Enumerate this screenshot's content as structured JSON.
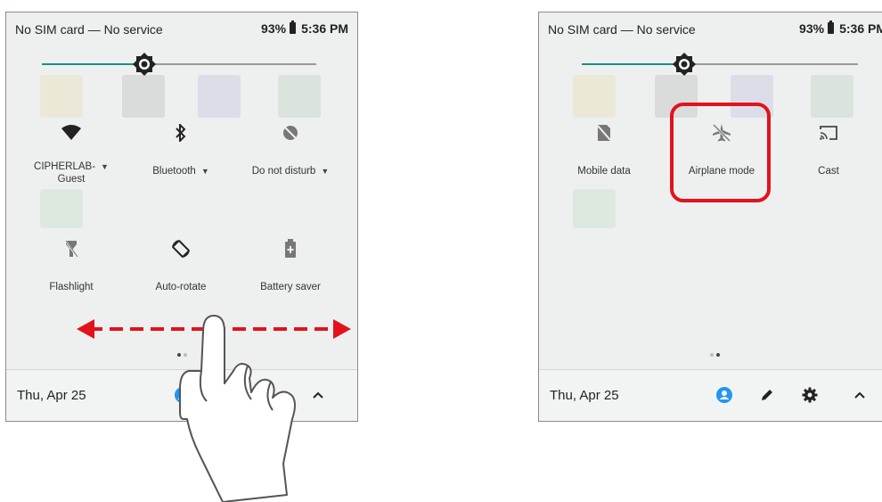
{
  "left_panel": {
    "status": {
      "carrier": "No SIM card — No service",
      "battery": "93%",
      "time": "5:36 PM"
    },
    "tiles": [
      {
        "label": "CIPHERLAB-\nGuest",
        "icon": "wifi-icon",
        "dropdown": true
      },
      {
        "label": "Bluetooth",
        "icon": "bluetooth-icon",
        "dropdown": true
      },
      {
        "label": "Do not disturb",
        "icon": "do-not-disturb-icon",
        "dropdown": true
      },
      {
        "label": "Flashlight",
        "icon": "flashlight-off-icon",
        "dropdown": false
      },
      {
        "label": "Auto-rotate",
        "icon": "auto-rotate-icon",
        "dropdown": false
      },
      {
        "label": "Battery saver",
        "icon": "battery-saver-icon",
        "dropdown": false
      }
    ],
    "page_indicator": {
      "pages": 2,
      "active": 0
    },
    "footer": {
      "date": "Thu, Apr 25"
    }
  },
  "right_panel": {
    "status": {
      "carrier": "No SIM card — No service",
      "battery": "93%",
      "time": "5:36 PM"
    },
    "tiles": [
      {
        "label": "Mobile data",
        "icon": "mobile-data-off-icon"
      },
      {
        "label": "Airplane mode",
        "icon": "airplane-mode-off-icon"
      },
      {
        "label": "Cast",
        "icon": "cast-icon"
      }
    ],
    "page_indicator": {
      "pages": 2,
      "active": 1
    },
    "footer": {
      "date": "Thu, Apr 25"
    }
  },
  "colors": {
    "accent": "#1a8f86",
    "user_icon": "#2196f3",
    "highlight": "#e3121b",
    "swipe_arrow": "#e3121b"
  }
}
